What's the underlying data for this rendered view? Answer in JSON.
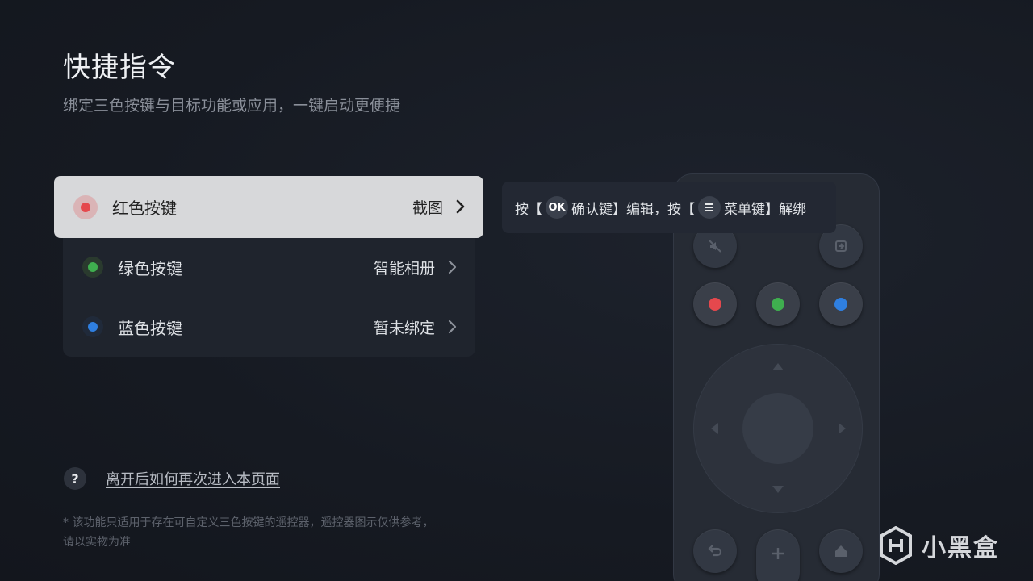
{
  "page": {
    "title": "快捷指令",
    "subtitle": "绑定三色按键与目标功能或应用，一键启动更便捷"
  },
  "options": [
    {
      "label": "红色按键",
      "value": "截图",
      "color": "#e5484d",
      "focused": true
    },
    {
      "label": "绿色按键",
      "value": "智能相册",
      "color": "#3fae4f",
      "focused": false
    },
    {
      "label": "蓝色按键",
      "value": "暂未绑定",
      "color": "#2f7fe0",
      "focused": false
    }
  ],
  "tooltip": {
    "prefix": "按【",
    "ok_key": "OK",
    "ok_text": "确认键】编辑，按【",
    "menu_key_icon": "menu-icon",
    "menu_text": "菜单键】解绑"
  },
  "remote": {
    "color_buttons": [
      "#e5484d",
      "#3fae4f",
      "#2f7fe0"
    ],
    "icons": [
      "mute-icon",
      "input-source-icon",
      "back-icon",
      "plus-icon",
      "home-icon"
    ]
  },
  "help": {
    "icon": "question-icon",
    "link_text": "离开后如何再次进入本页面"
  },
  "footnote": {
    "line1": "* 该功能只适用于存在可自定义三色按键的遥控器，遥控器图示仅供参考，",
    "line2": "请以实物为准"
  },
  "watermark": {
    "text": "小黑盒"
  }
}
